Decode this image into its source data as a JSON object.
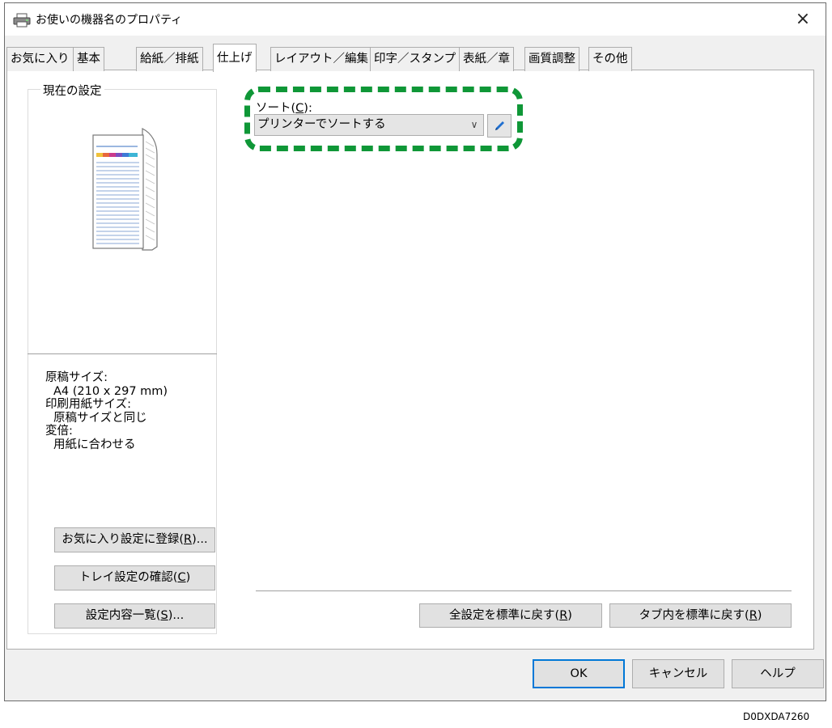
{
  "window": {
    "title": "お使いの機器名のプロパティ",
    "close_glyph": "×"
  },
  "tabs": [
    {
      "label": "お気に入り"
    },
    {
      "label": "基本"
    },
    {
      "label": "給紙／排紙"
    },
    {
      "label": "仕上げ",
      "selected": true
    },
    {
      "label": "レイアウト／編集"
    },
    {
      "label": "印字／スタンプ"
    },
    {
      "label": "表紙／章"
    },
    {
      "label": "画質調整"
    },
    {
      "label": "その他"
    }
  ],
  "current_settings": {
    "group_label": "現在の設定",
    "lines": [
      "原稿サイズ:",
      "A4 (210 x 297 mm)",
      "印刷用紙サイズ:",
      "原稿サイズと同じ",
      "変倍:",
      "用紙に合わせる"
    ],
    "register_favorite": {
      "text": "お気に入り設定に登録",
      "key": "R",
      "suffix": "..."
    },
    "tray_check": {
      "text": "トレイ設定の確認",
      "key": "C",
      "suffix": ""
    },
    "settings_list": {
      "text": "設定内容一覧",
      "key": "S",
      "suffix": "..."
    }
  },
  "sort": {
    "label": {
      "text": "ソート",
      "key": "C",
      "suffix": ":"
    },
    "value": "プリンターでソートする",
    "chevron": "∨",
    "edit_icon": "pencil-icon"
  },
  "bottom_buttons": {
    "reset_all": {
      "text": "全設定を標準に戻す",
      "key": "R"
    },
    "reset_tab": {
      "text": "タブ内を標準に戻す",
      "key": "R"
    }
  },
  "dialog_buttons": {
    "ok": "OK",
    "cancel": "キャンセル",
    "help": "ヘルプ"
  },
  "footer_code": "D0DXDA7260",
  "colors": {
    "highlight": "#0f9737",
    "focus_border": "#0078d7",
    "pencil": "#1f6fd0"
  }
}
